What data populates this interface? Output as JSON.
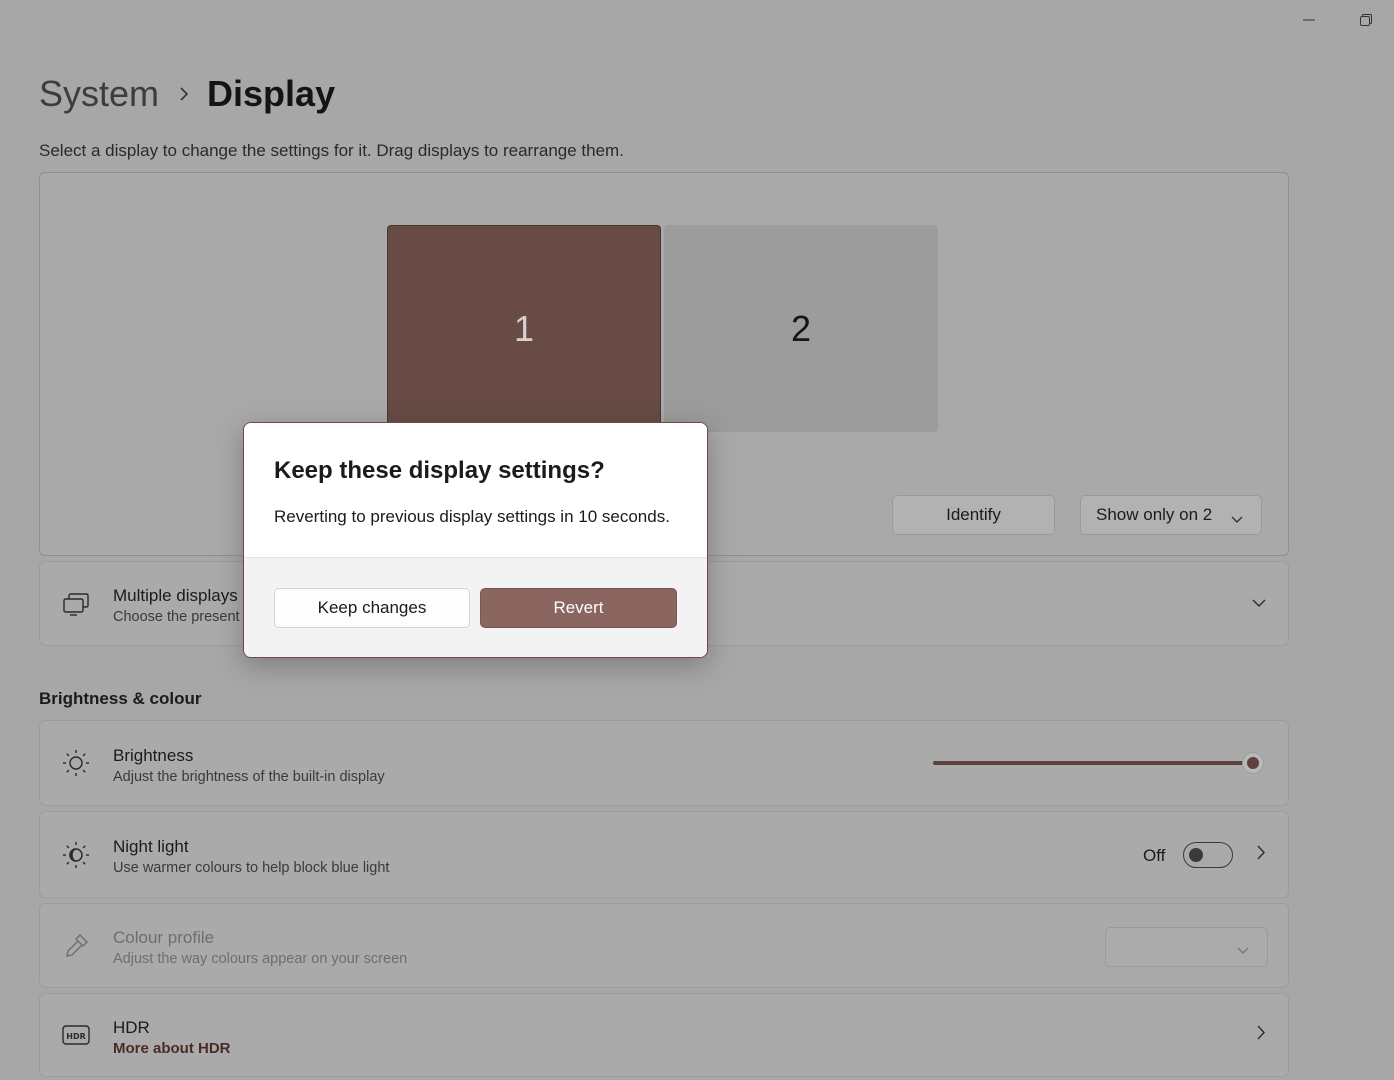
{
  "window": {
    "minimize_icon": "minimize-icon",
    "restore_icon": "restore-icon"
  },
  "breadcrumb": {
    "parent": "System",
    "current": "Display"
  },
  "subtitle": "Select a display to change the settings for it. Drag displays to rearrange them.",
  "arrangement": {
    "monitors": [
      {
        "label": "1",
        "selected": true
      },
      {
        "label": "2",
        "selected": false
      }
    ],
    "identify_label": "Identify",
    "mode_selected": "Show only on 2"
  },
  "multiple_displays": {
    "title": "Multiple displays",
    "description": "Choose the present"
  },
  "section_brightness": "Brightness & colour",
  "brightness": {
    "title": "Brightness",
    "description": "Adjust the brightness of the built-in display",
    "value_percent": 100
  },
  "night_light": {
    "title": "Night light",
    "description": "Use warmer colours to help block blue light",
    "state_label": "Off"
  },
  "colour_profile": {
    "title": "Colour profile",
    "description": "Adjust the way colours appear on your screen"
  },
  "hdr": {
    "title": "HDR",
    "link": "More about HDR"
  },
  "dialog": {
    "title": "Keep these display settings?",
    "message": "Reverting to previous display settings in 10 seconds.",
    "keep_label": "Keep changes",
    "revert_label": "Revert"
  },
  "colors": {
    "accent": "#8b6660",
    "accent_dark": "#5e413c",
    "selected_monitor": "#684b45"
  }
}
